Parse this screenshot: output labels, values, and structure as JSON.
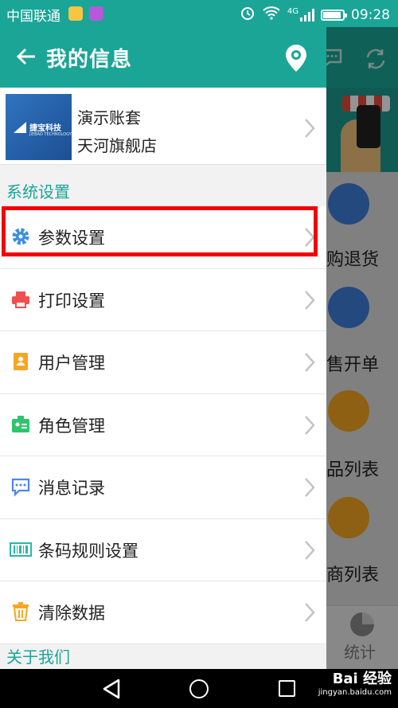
{
  "status_bar": {
    "carrier": "中国联通",
    "network": "4G",
    "time": "09:28"
  },
  "drawer": {
    "title": "我的信息",
    "account": {
      "logo_text": "捷宝科技",
      "logo_subtext": "JIEBAO TECHNOLOGY",
      "name": "演示账套",
      "store": "天河旗舰店"
    },
    "section_system": "系统设置",
    "menu": [
      {
        "label": "参数设置",
        "icon": "gear-icon",
        "color": "#3d8fe0"
      },
      {
        "label": "打印设置",
        "icon": "printer-icon",
        "color": "#f0504f"
      },
      {
        "label": "用户管理",
        "icon": "contacts-book-icon",
        "color": "#f5a623"
      },
      {
        "label": "角色管理",
        "icon": "id-card-icon",
        "color": "#2ec56e"
      },
      {
        "label": "消息记录",
        "icon": "chat-bubble-icon",
        "color": "#4f86e8"
      },
      {
        "label": "条码规则设置",
        "icon": "barcode-icon",
        "color": "#27b8a6"
      },
      {
        "label": "清除数据",
        "icon": "trash-icon",
        "color": "#f5a623"
      }
    ],
    "section_about": "关于我们",
    "highlighted_item": "参数设置"
  },
  "background": {
    "tiles": [
      {
        "label": "购退货",
        "color": "#3f7fd9"
      },
      {
        "label": "销售开单",
        "color": "#3f7fd9"
      },
      {
        "label": "商品列表",
        "color": "#f5a623"
      },
      {
        "label": "供应商列表",
        "color": "#f5a623"
      }
    ],
    "bottom_tab": "统计"
  },
  "watermark": {
    "main": "Bai 经验",
    "sub": "jingyan.baidu.com"
  },
  "colors": {
    "accent": "#1aa597",
    "highlight_border": "#f30000"
  }
}
